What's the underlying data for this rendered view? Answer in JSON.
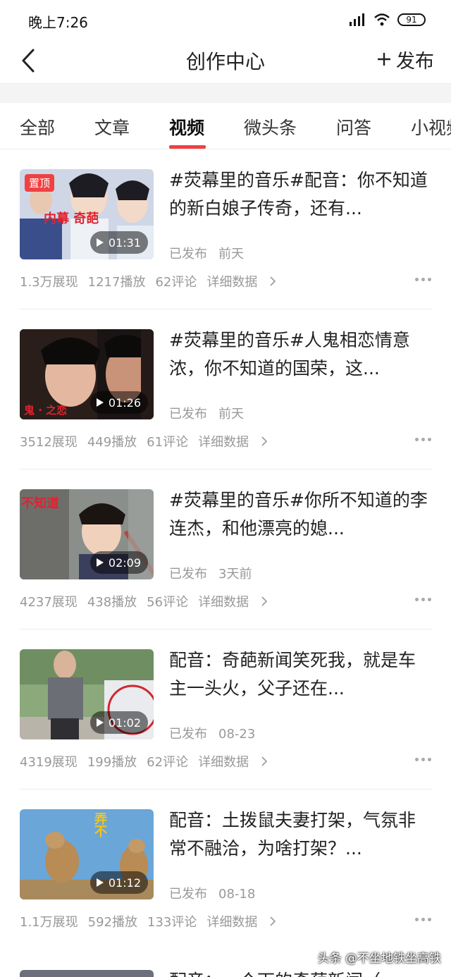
{
  "status_bar": {
    "time": "晚上7:26",
    "battery": "91"
  },
  "nav": {
    "title": "创作中心",
    "publish_label": "发布"
  },
  "tabs": [
    {
      "label": "全部"
    },
    {
      "label": "文章"
    },
    {
      "label": "视频"
    },
    {
      "label": "微头条"
    },
    {
      "label": "问答"
    },
    {
      "label": "小视频"
    }
  ],
  "active_tab": "视频",
  "items": [
    {
      "pinned_badge": "置顶",
      "overlay": "内幕  奇葩",
      "duration": "01:31",
      "title": "#荧幕里的音乐#配音：你不知道的新白娘子传奇，还有...",
      "status": "已发布",
      "time": "前天",
      "impressions": "1.3万展现",
      "plays": "1217播放",
      "comments": "62评论",
      "detail": "详细数据"
    },
    {
      "overlay": "鬼 · 之恋",
      "duration": "01:26",
      "title": "#荧幕里的音乐#人鬼相恋情意浓，你不知道的国荣，这...",
      "status": "已发布",
      "time": "前天",
      "impressions": "3512展现",
      "plays": "449播放",
      "comments": "61评论",
      "detail": "详细数据"
    },
    {
      "overlay": "不知道",
      "duration": "02:09",
      "title": "#荧幕里的音乐#你所不知道的李连杰，和他漂亮的媳...",
      "status": "已发布",
      "time": "3天前",
      "impressions": "4237展现",
      "plays": "438播放",
      "comments": "56评论",
      "detail": "详细数据"
    },
    {
      "overlay": "",
      "duration": "01:02",
      "title": "配音：奇葩新闻笑死我，就是车主一头火，父子还在...",
      "status": "已发布",
      "time": "08-23",
      "impressions": "4319展现",
      "plays": "199播放",
      "comments": "62评论",
      "detail": "详细数据"
    },
    {
      "overlay": "弄不",
      "duration": "01:12",
      "title": "配音：土拨鼠夫妻打架，气氛非常不融洽，为啥打架？...",
      "status": "已发布",
      "time": "08-18",
      "impressions": "1.1万展现",
      "plays": "592播放",
      "comments": "133评论",
      "detail": "详细数据"
    }
  ],
  "partial_item": {
    "title": "配音：一个下的奇葩新闻（"
  },
  "watermark": "头条 @不坐地铁坐高铁",
  "colors": {
    "accent": "#f04142",
    "text": "#222222",
    "muted": "#999999"
  }
}
